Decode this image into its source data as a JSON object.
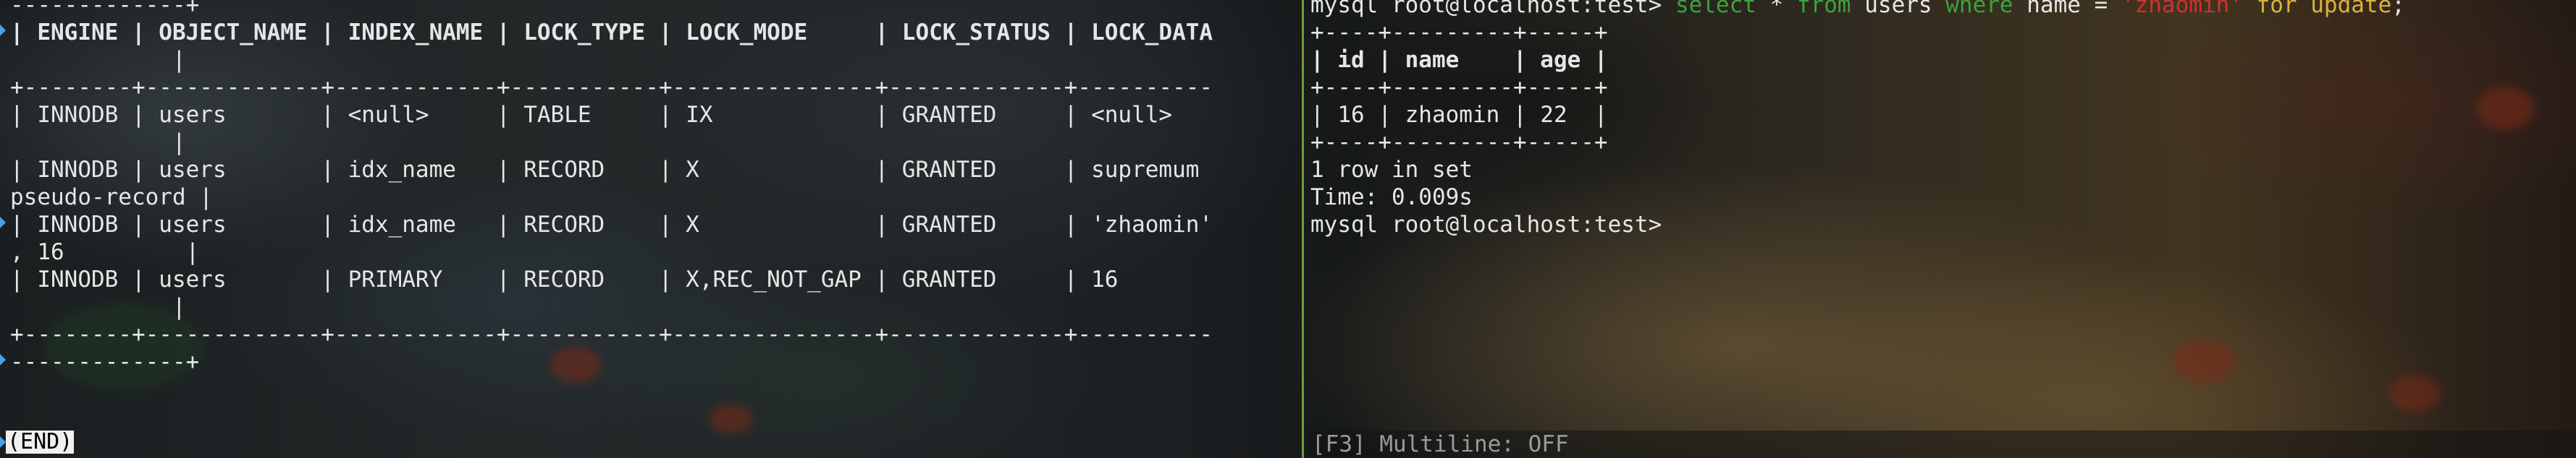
{
  "left_pane": {
    "lines": [
      "-------------+",
      "| ENGINE | OBJECT_NAME | INDEX_NAME | LOCK_TYPE | LOCK_MODE     | LOCK_STATUS | LOCK_DATA",
      "            |",
      "+--------+-------------+------------+-----------+---------------+-------------+----------",
      "| INNODB | users       | <null>     | TABLE     | IX            | GRANTED     | <null>",
      "            |",
      "| INNODB | users       | idx_name   | RECORD    | X             | GRANTED     | supremum",
      "pseudo-record |",
      "| INNODB | users       | idx_name   | RECORD    | X             | GRANTED     | 'zhaomin'",
      ", 16         |",
      "| INNODB | users       | PRIMARY    | RECORD    | X,REC_NOT_GAP | GRANTED     | 16",
      "            |",
      "+--------+-------------+------------+-----------+---------------+-------------+----------",
      "-------------+"
    ],
    "end_label": "(END)"
  },
  "right_pane": {
    "prompt": "mysql root@localhost:test>",
    "query": {
      "select": "select",
      "star": "*",
      "from": "from",
      "table": "users",
      "where": "where",
      "column": "name",
      "eq": "=",
      "value": "'zhaomin'",
      "for_update": "for update",
      "semicolon": ";"
    },
    "table_lines": [
      "+----+---------+-----+",
      "| id | name    | age |",
      "+----+---------+-----+",
      "| 16 | zhaomin | 22  |",
      "+----+---------+-----+"
    ],
    "rows_info": "1 row in set",
    "time_info": "Time: 0.009s",
    "prompt2": "mysql root@localhost:test>",
    "status_bar": "[F3] Multiline: OFF"
  },
  "colors": {
    "divider": "#6f9a3a",
    "keyword": "#3aa43a",
    "string": "#d03030",
    "for_update": "#d8b23a",
    "text": "#e6e6e6"
  }
}
